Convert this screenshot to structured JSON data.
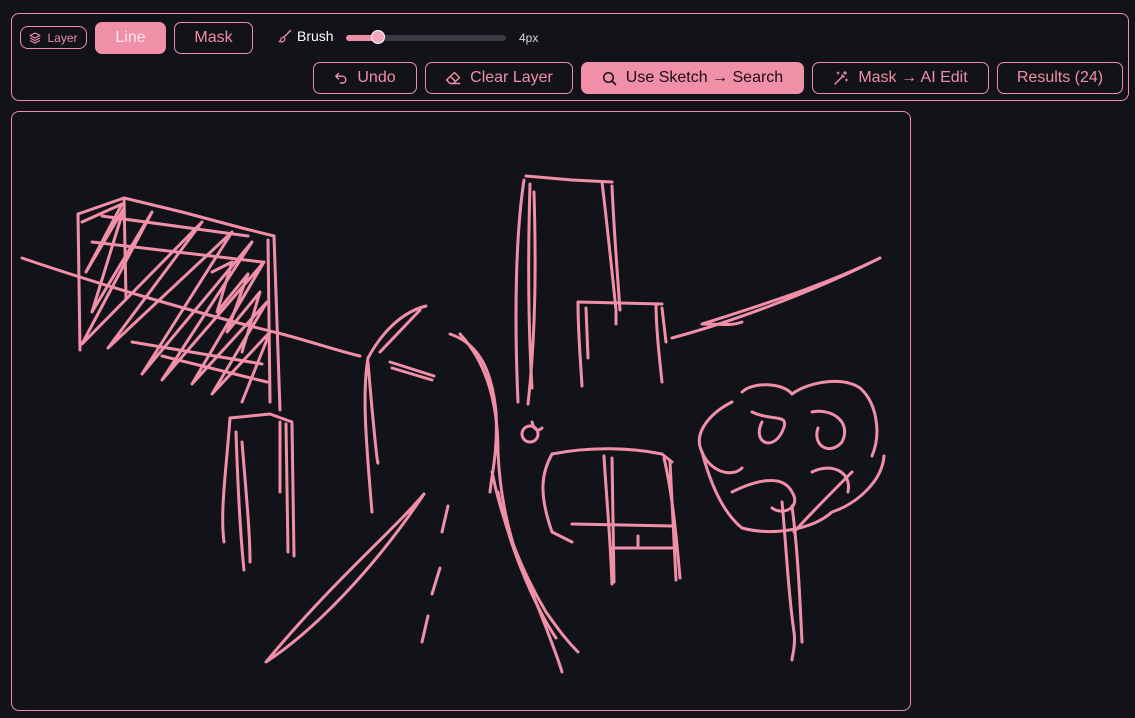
{
  "toolbar": {
    "layer_label": "Layer",
    "mode_line_label": "Line",
    "mode_mask_label": "Mask",
    "active_mode": "Line",
    "brush_label": "Brush",
    "brush_size": 4,
    "brush_size_min": 1,
    "brush_size_max": 40,
    "brush_value_text": "4px",
    "undo_label": "Undo",
    "clear_label": "Clear Layer",
    "search_label": "Use Sketch → Search",
    "mask_ai_label": "Mask → AI Edit",
    "results_label": "Results (24)"
  },
  "colors": {
    "accent": "#f08fa8",
    "background": "#121219",
    "stroke": "#f08fa8"
  },
  "icons": {
    "layer": "layers-icon",
    "brush": "brush-icon",
    "undo": "undo-icon",
    "clear": "eraser-icon",
    "search": "search-icon",
    "mask_ai": "magic-wand-icon"
  }
}
